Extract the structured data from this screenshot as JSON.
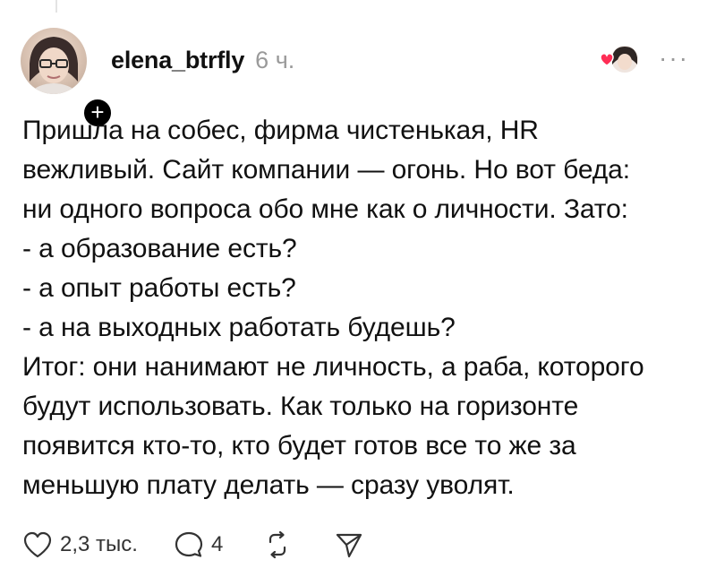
{
  "post": {
    "username": "elena_btrfly",
    "time": "6 ч.",
    "follow_symbol": "+",
    "more_symbol": "···",
    "lines": [
      "Пришла на собес, фирма чистенькая, HR",
      "вежливый. Сайт компании — огонь. Но вот беда:",
      "ни одного вопроса обо мне как о личности. Зато:",
      "- а образование есть?",
      "- а опыт работы есть?",
      "- а на выходных работать будешь?",
      "Итог: они нанимают не личность, а раба, которого",
      "будут использовать. Как только на горизонте",
      "появится кто-то, кто будет готов все то же за",
      "меньшую плату делать — сразу уволят."
    ]
  },
  "actions": {
    "likes": "2,3 тыс.",
    "comments": "4"
  },
  "icons": {
    "like": "heart-icon",
    "comment": "comment-icon",
    "repost": "repost-icon",
    "share": "share-icon",
    "more": "more-icon"
  },
  "colors": {
    "accent_heart": "#ff2d55",
    "muted": "#9a9a9a"
  }
}
